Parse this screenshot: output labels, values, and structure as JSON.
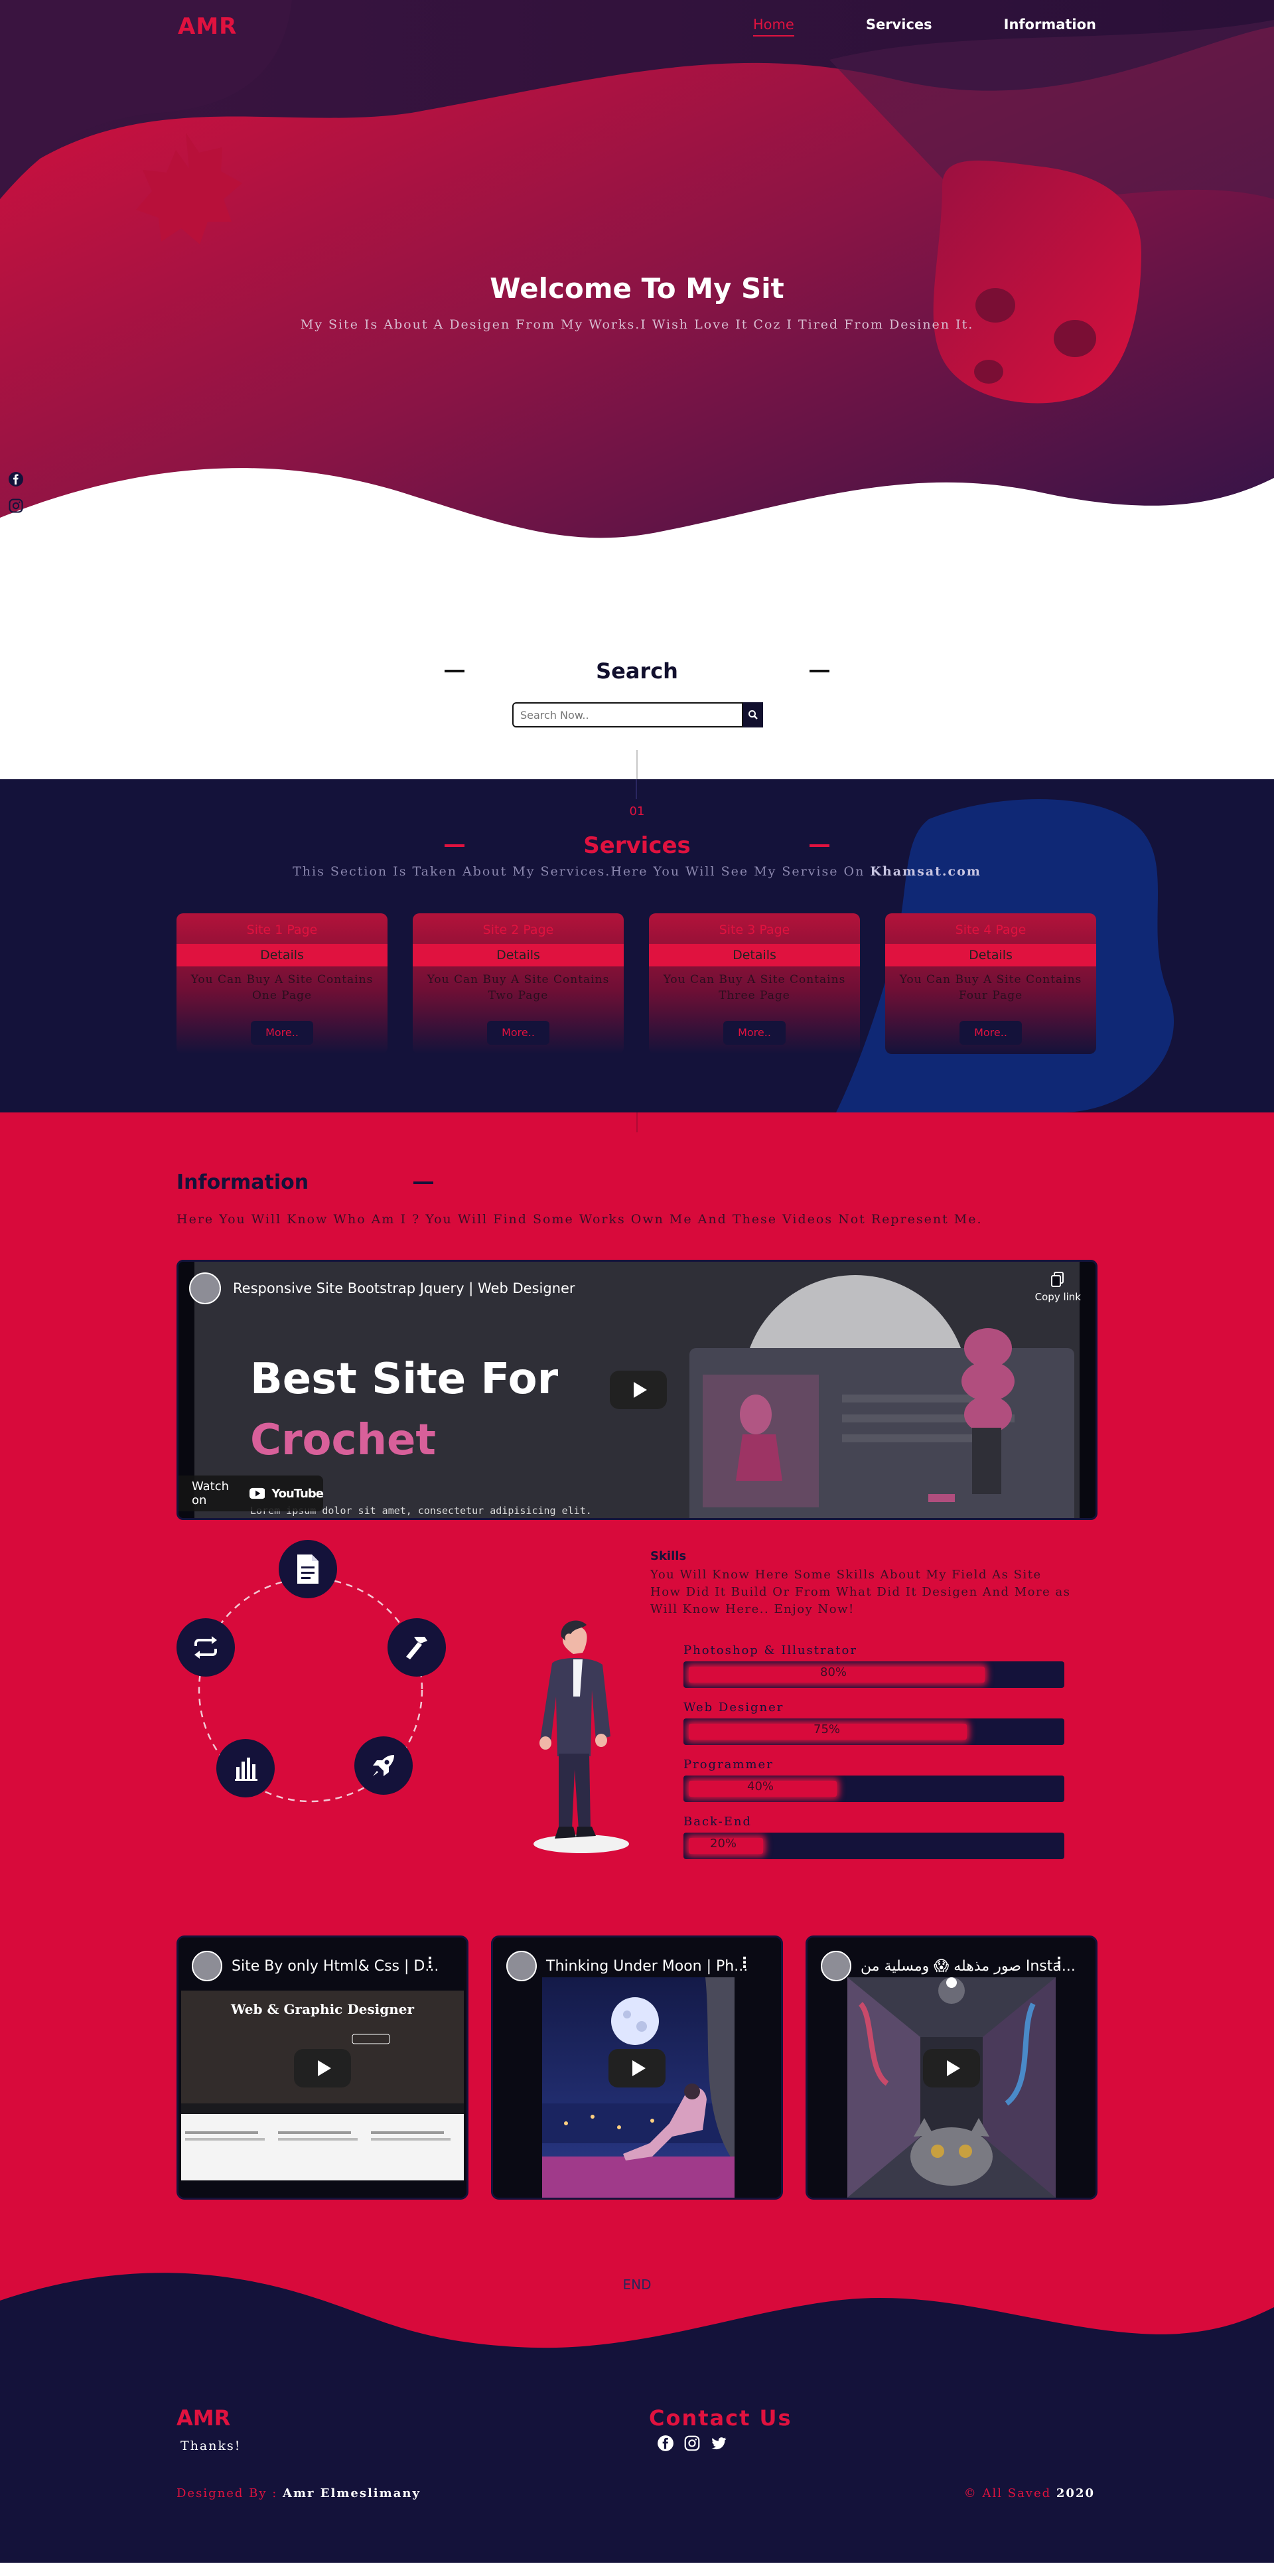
{
  "nav": {
    "logo": "AMR",
    "links": [
      {
        "label": "Home",
        "active": true
      },
      {
        "label": "Services",
        "active": false
      },
      {
        "label": "Information",
        "active": false
      }
    ]
  },
  "hero": {
    "title": "Welcome To My Sit",
    "subtitle": "My Site Is About A Desigen From My Works.I Wish Love It Coz I Tired From Desinen It.",
    "social_icons": [
      "facebook-icon",
      "instagram-icon"
    ]
  },
  "search": {
    "title": "Search",
    "placeholder": "Search Now..",
    "button_icon": "search-icon"
  },
  "services": {
    "number": "01",
    "title": "Services",
    "subtitle_prefix": "This Section Is Taken About My Services.Here You Will See My Servise On ",
    "subtitle_link": "Khamsat.com",
    "cards": [
      {
        "title": "Site 1 Page",
        "details": "Details",
        "text": "You Can Buy A Site Contains One Page",
        "more": "More.."
      },
      {
        "title": "Site 2 Page",
        "details": "Details",
        "text": "You Can Buy A Site Contains Two Page",
        "more": "More.."
      },
      {
        "title": "Site 3 Page",
        "details": "Details",
        "text": "You Can Buy A Site Contains Three Page",
        "more": "More.."
      },
      {
        "title": "Site 4 Page",
        "details": "Details",
        "text": "You Can Buy A Site Contains Four Page",
        "more": "More.."
      }
    ]
  },
  "info": {
    "title": "Information",
    "subtitle": "Here You Will Know Who Am I ? You Will Find Some Works Own Me And These Videos Not Represent Me.",
    "main_video": {
      "title": "Responsive Site Bootstrap Jquery | Web Designer",
      "copy_label": "Copy link",
      "watch_on": "Watch on",
      "youtube": "YouTube",
      "thumb_line1": "Best Site For",
      "thumb_line2": "Crochet",
      "thumb_caption": "Lorem ipsum dolor sit amet, consectetur adipisicing elit."
    },
    "circle_icons": [
      "document-icon",
      "hammer-icon",
      "rocket-icon",
      "bar-chart-icon",
      "repeat-icon"
    ],
    "skills": {
      "title": "Skills",
      "text": "You Will Know Here Some Skills About My Field As Site How Did It Build Or From What Did It Desigen And More as Will Know Here.. Enjoy Now!",
      "items": [
        {
          "label": "Photoshop & Illustrator",
          "value": "80%",
          "fraction": 0.8
        },
        {
          "label": "Web Designer",
          "value": "75%",
          "fraction": 0.75
        },
        {
          "label": "Programmer",
          "value": "40%",
          "fraction": 0.4
        },
        {
          "label": "Back-End",
          "value": "20%",
          "fraction": 0.2
        }
      ]
    },
    "videos": [
      {
        "title": "Site By only Html& Css | D...",
        "thumb_heading": "Web & Graphic Designer"
      },
      {
        "title": "Thinking Under Moon | Ph..."
      },
      {
        "title": "صور مذهله 😱 ومسلية من Insta..."
      }
    ]
  },
  "footer": {
    "end": "END",
    "logo": "AMR",
    "thanks": "Thanks!",
    "contact_title": "Contact Us",
    "social_icons": [
      "facebook-icon",
      "instagram-icon",
      "twitter-icon"
    ],
    "designed_by_label": "Designed By :",
    "designed_by_name": "Amr Elmeslimany",
    "saved_label": "© All Saved",
    "saved_year": "2020"
  },
  "colors": {
    "accent": "#e0123f",
    "navy": "#14123a",
    "info_bg": "#d80a3b",
    "hero_purple": "#3a1440"
  }
}
